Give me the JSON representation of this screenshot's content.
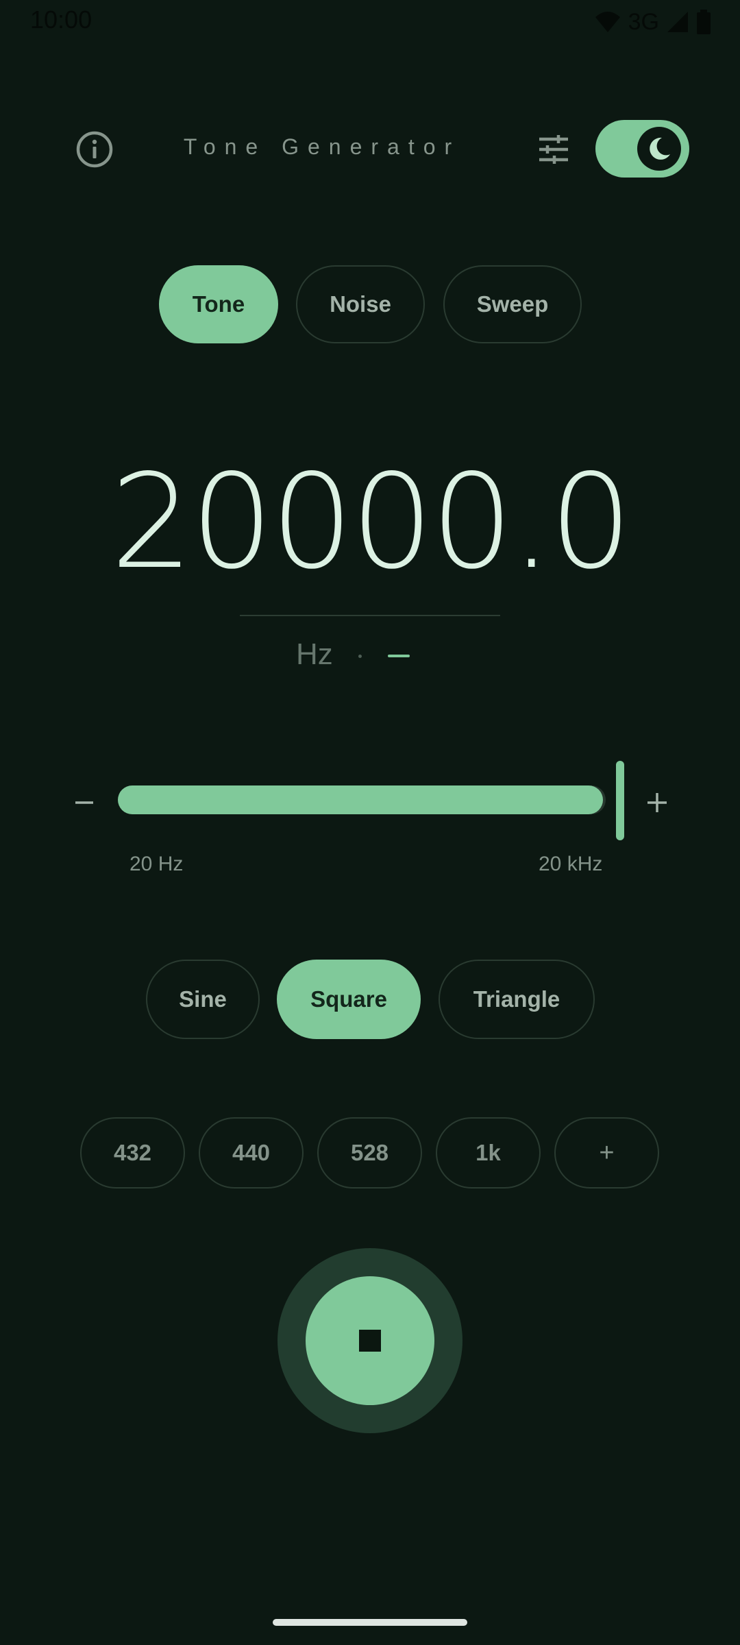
{
  "status": {
    "time": "10:00",
    "network": "3G"
  },
  "header": {
    "title": "Tone Generator",
    "info_icon": "info-icon",
    "settings_icon": "tune-sliders-icon",
    "theme_icon": "moon-icon"
  },
  "modes": [
    {
      "label": "Tone",
      "selected": true
    },
    {
      "label": "Noise",
      "selected": false
    },
    {
      "label": "Sweep",
      "selected": false
    }
  ],
  "frequency": {
    "value": "20000.0",
    "unit": "Hz"
  },
  "slider": {
    "min_label": "20 Hz",
    "max_label": "20 kHz",
    "level_fraction": 1.0,
    "minus": "−",
    "plus": "+"
  },
  "waveforms": [
    {
      "label": "Sine",
      "selected": false
    },
    {
      "label": "Square",
      "selected": true
    },
    {
      "label": "Triangle",
      "selected": false
    }
  ],
  "presets": [
    "432",
    "440",
    "528",
    "1k",
    "+"
  ],
  "colors": {
    "accent": "#80c99a",
    "background": "#0c1812"
  }
}
